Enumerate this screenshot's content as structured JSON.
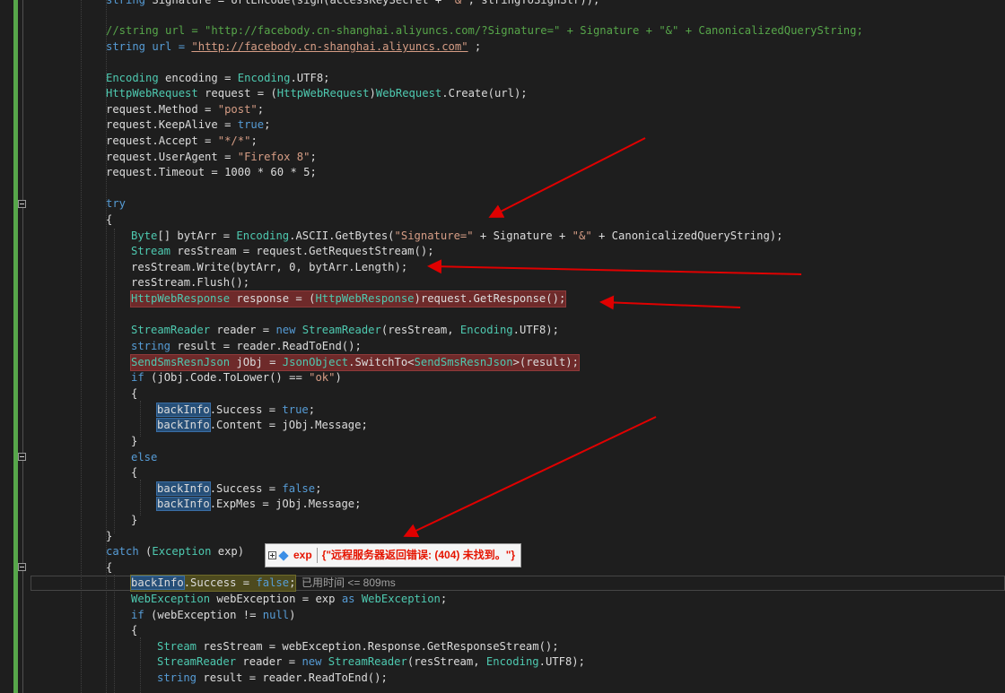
{
  "editor": {
    "language": "C#",
    "lines": {
      "l01": "string Signature = UrlEncode(sign(accessKeySecret + \"&\", stringToSignStr));",
      "l02": "//string url = \"http://facebody.cn-shanghai.aliyuncs.com/?Signature=\" + Signature + \"&\" + CanonicalizedQueryString;",
      "l03_a": "string url = ",
      "l03_b": "\"http://facebody.cn-shanghai.aliyuncs.com\"",
      "l03_c": " ;",
      "l04": "Encoding encoding = Encoding.UTF8;",
      "l05": "HttpWebRequest request = (HttpWebRequest)WebRequest.Create(url);",
      "l06": "request.Method = \"post\";",
      "l07": "request.KeepAlive = true;",
      "l08": "request.Accept = \"*/*\";",
      "l09": "request.UserAgent = \"Firefox 8\";",
      "l10": "request.Timeout = 1000 * 60 * 5;",
      "l11": "try",
      "l12": "{",
      "l13": "Byte[] bytArr = Encoding.ASCII.GetBytes(\"Signature=\" + Signature + \"&\" + CanonicalizedQueryString);",
      "l14": "Stream resStream = request.GetRequestStream();",
      "l15": "resStream.Write(bytArr, 0, bytArr.Length);",
      "l16": "resStream.Flush();",
      "l17": "HttpWebResponse response = (HttpWebResponse)request.GetResponse();",
      "l18": "StreamReader reader = new StreamReader(resStream, Encoding.UTF8);",
      "l19": "string result = reader.ReadToEnd();",
      "l20": "SendSmsResnJson jObj = JsonObject.SwitchTo<SendSmsResnJson>(result);",
      "l21": "if (jObj.Code.ToLower() == \"ok\")",
      "l22": "{",
      "l23": "backInfo.Success = true;",
      "l24": "backInfo.Content = jObj.Message;",
      "l25": "}",
      "l26": "else",
      "l27": "{",
      "l28": "backInfo.Success = false;",
      "l29": "backInfo.ExpMes = jObj.Message;",
      "l30": "}",
      "l31": "}",
      "l32": "catch (Exception exp)",
      "l33": "{",
      "l34": "backInfo.Success = false;",
      "l35": "WebException webException = exp as WebException;",
      "l36": "if (webException != null)",
      "l37": "{",
      "l38": "Stream resStream = webException.Response.GetResponseStream();",
      "l39": "StreamReader reader = new StreamReader(resStream, Encoding.UTF8);",
      "l40": "string result = reader.ReadToEnd();"
    }
  },
  "datatip": {
    "expand_icon": "plus-box-icon",
    "type_icon": "field-icon",
    "name": "exp",
    "value": "{\"远程服务器返回错误: (404) 未找到。\"}"
  },
  "perf_tip": {
    "label": "已用时间 <= 809ms"
  },
  "colors": {
    "background": "#1e1e1e",
    "keyword": "#569cd6",
    "type": "#4ec9b0",
    "string": "#d69d85",
    "comment": "#57a64a",
    "breakpoint_highlight": "#6e2a2a",
    "reference_highlight": "#264f78",
    "annotation_arrow": "#e00000"
  }
}
